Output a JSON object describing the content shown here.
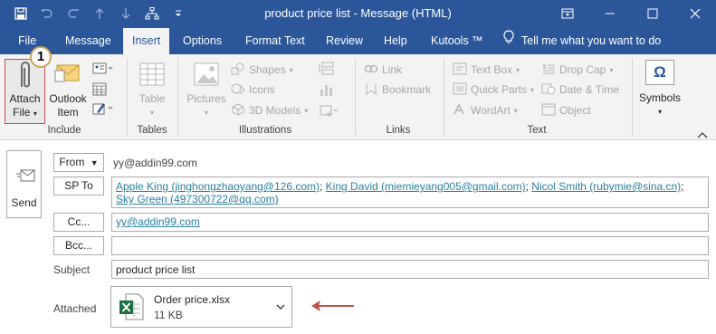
{
  "title_bar": {
    "title": "product price list  -  Message (HTML)",
    "quick_access": [
      "save-icon",
      "undo-icon",
      "redo-icon",
      "up-arrow-icon",
      "down-arrow-icon",
      "network-icon",
      "customize-icon"
    ],
    "window_controls": [
      "ribbon-display-icon",
      "minimize-icon",
      "maximize-icon",
      "close-icon"
    ]
  },
  "tabs": {
    "file": "File",
    "message": "Message",
    "insert": "Insert",
    "options": "Options",
    "format_text": "Format Text",
    "review": "Review",
    "help": "Help",
    "kutools": "Kutools ™",
    "tell_me": "Tell me what you want to do"
  },
  "ribbon": {
    "include": {
      "label": "Include",
      "attach_file_line1": "Attach",
      "attach_file_line2": "File",
      "outlook_item_line1": "Outlook",
      "outlook_item_line2": "Item",
      "badge": "1"
    },
    "tables": {
      "label": "Tables",
      "table": "Table"
    },
    "illustrations": {
      "label": "Illustrations",
      "pictures": "Pictures",
      "shapes": "Shapes",
      "icons": "Icons",
      "models_3d": "3D Models"
    },
    "links": {
      "label": "Links",
      "link": "Link",
      "bookmark": "Bookmark"
    },
    "text": {
      "label": "Text",
      "text_box": "Text Box",
      "quick_parts": "Quick Parts",
      "wordart": "WordArt",
      "drop_cap": "Drop Cap",
      "date_time": "Date & Time",
      "object": "Object"
    },
    "symbols": {
      "label": "Symbols",
      "omega": "Ω"
    }
  },
  "compose": {
    "send": "Send",
    "from_button": "From",
    "from_value": "yy@addin99.com",
    "to_button": "SP To",
    "to_recipients": [
      "Apple King (jinghongzhaoyang@126.com)",
      "King David (miemieyang005@gmail.com)",
      "Nicol Smith (rubymie@sina.cn)",
      "Sky Green (497300722@qq.com)"
    ],
    "cc_button": "Cc...",
    "cc_value": "yy@addin99.com",
    "bcc_button": "Bcc...",
    "bcc_value": "",
    "subject_label": "Subject",
    "subject_value": "product price list",
    "attached_label": "Attached",
    "attachment": {
      "name": "Order price.xlsx",
      "size": "11 KB",
      "icon": "excel-icon"
    }
  },
  "colors": {
    "accent": "#2b579a",
    "link": "#2b7f9c",
    "highlight_border": "#c0504d",
    "arrow": "#c0504d",
    "excel_green": "#1d6f42"
  }
}
